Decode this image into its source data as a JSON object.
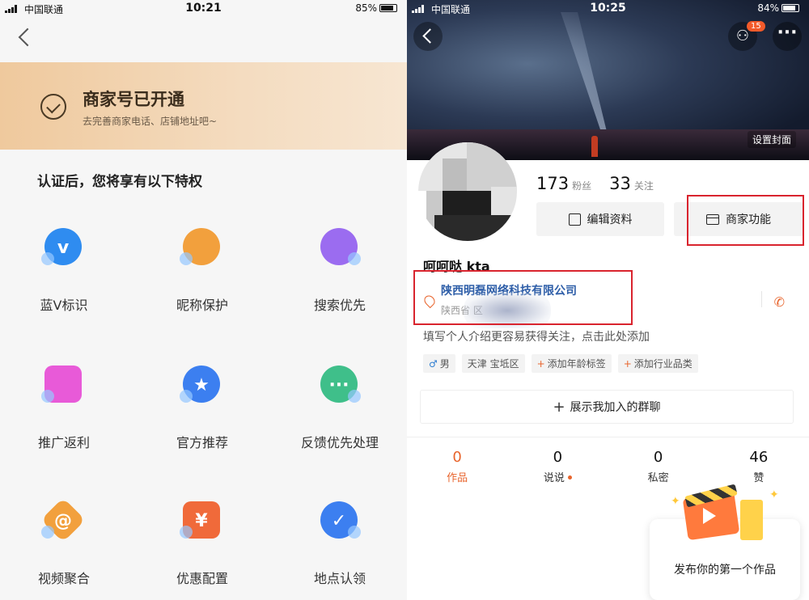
{
  "left_phone": {
    "status": {
      "carrier": "中国联通",
      "time": "10:21",
      "battery": "85%"
    },
    "banner": {
      "title": "商家号已开通",
      "subtitle": "去完善商家电话、店铺地址吧~"
    },
    "perks_title": "认证后，您将享有以下特权",
    "perks": [
      {
        "label": "蓝V标识",
        "icon": "blue-v-icon",
        "color": "#2f8cf0"
      },
      {
        "label": "昵称保护",
        "icon": "person-shield-icon",
        "color": "#f2a03d"
      },
      {
        "label": "搜索优先",
        "icon": "search-magnifier-icon",
        "color": "#9b6cf0"
      },
      {
        "label": "推广返利",
        "icon": "shopping-bag-icon",
        "color": "#e85ad8"
      },
      {
        "label": "官方推荐",
        "icon": "star-bookmark-icon",
        "color": "#3c7ff0"
      },
      {
        "label": "反馈优先处理",
        "icon": "chat-bubble-icon",
        "color": "#3fbf8a"
      },
      {
        "label": "视频聚合",
        "icon": "at-hexagon-icon",
        "color": "#f2a03d"
      },
      {
        "label": "优惠配置",
        "icon": "coupon-yen-icon",
        "color": "#f06a3a"
      },
      {
        "label": "地点认领",
        "icon": "location-check-icon",
        "color": "#3c7ff0"
      }
    ],
    "perk_glyphs": [
      "v",
      "",
      "",
      "",
      "★",
      "···",
      "@",
      "¥",
      "✓"
    ]
  },
  "right_phone": {
    "status": {
      "carrier": "中国联通",
      "time": "10:25",
      "battery": "84%"
    },
    "friend_badge": "15",
    "set_cover": "设置封面",
    "followers_count": "173",
    "followers_label": "粉丝",
    "following_count": "33",
    "following_label": "关注",
    "edit_profile": "编辑资料",
    "merchant_functions": "商家功能",
    "name": "呵呵哒 kta",
    "company": "陕西明磊网络科技有限公司",
    "address": "陕西省                区",
    "bio": "填写个人介绍更容易获得关注，点击此处添加",
    "tags": [
      {
        "text": "男",
        "kind": "gender"
      },
      {
        "text": "天津 宝坻区",
        "kind": "plain"
      },
      {
        "text": "添加年龄标签",
        "kind": "add"
      },
      {
        "text": "添加行业品类",
        "kind": "add"
      }
    ],
    "group_button": "展示我加入的群聊",
    "tabs": [
      {
        "count": "0",
        "label": "作品",
        "active": true
      },
      {
        "count": "0",
        "label": "说说",
        "active": false
      },
      {
        "count": "0",
        "label": "私密",
        "active": false
      },
      {
        "count": "46",
        "label": "赞",
        "active": false
      }
    ],
    "publish_label": "发布你的第一个作品",
    "highlight_color": "#d9242e",
    "accent_color": "#e8642c"
  }
}
